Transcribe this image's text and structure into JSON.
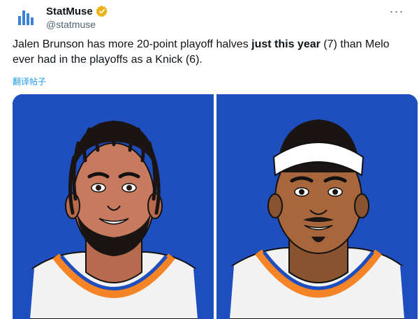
{
  "account": {
    "display_name": "StatMuse",
    "handle": "@statmuse",
    "verified": true,
    "avatar_icon": "statmuse-logo-icon"
  },
  "tweet": {
    "text_part1": "Jalen Brunson has more 20-point playoff halves ",
    "text_bold": "just this year",
    "text_part2": " (7) than Melo ever had in the playoffs as a Knick (6)."
  },
  "translate_label": "翻译帖子",
  "more_label": "···",
  "media": {
    "left_image": "jalen-brunson-illustration",
    "right_image": "carmelo-anthony-illustration",
    "background_color": "#1f4fbf"
  },
  "colors": {
    "link": "#1d9bf0",
    "verified": "#e8b416",
    "jersey_orange": "#f58426",
    "jersey_blue": "#1d4ebf"
  }
}
